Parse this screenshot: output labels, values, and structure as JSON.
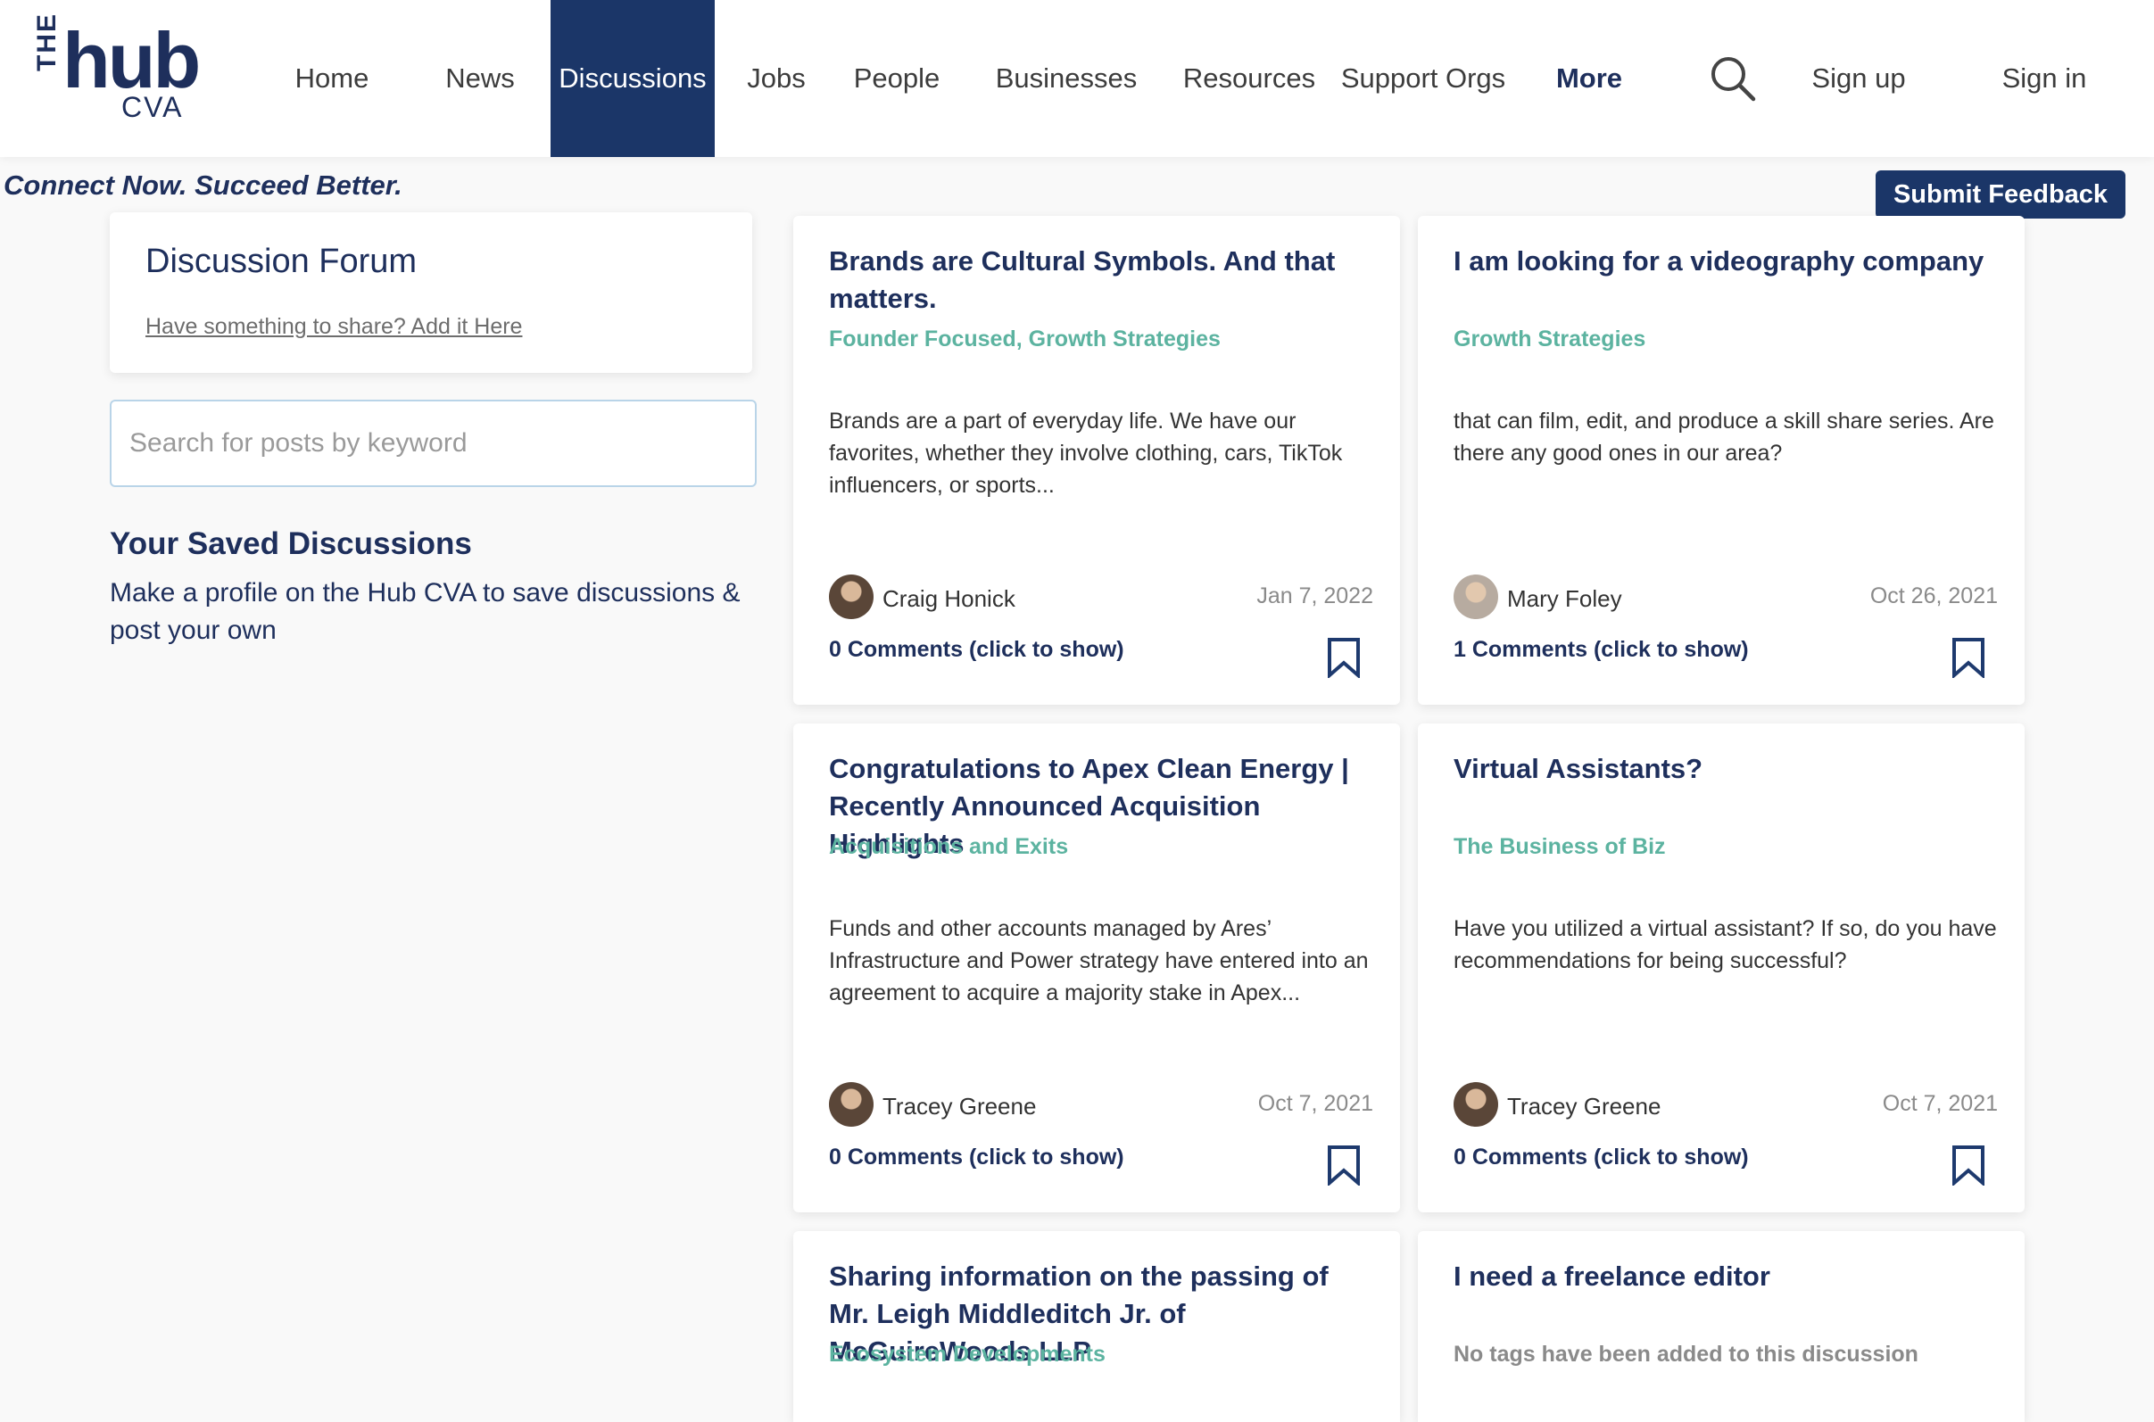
{
  "logo": {
    "the": "THE",
    "hub": "hub",
    "cva": "CVA"
  },
  "nav": {
    "items": [
      "Home",
      "News",
      "Discussions",
      "Jobs",
      "People",
      "Businesses",
      "Resources",
      "Support Orgs",
      "More"
    ],
    "active": "Discussions",
    "sign_up": "Sign up",
    "sign_in": "Sign in"
  },
  "tagline": "Connect Now. Succeed Better.",
  "feedback_label": "Submit Feedback",
  "forum": {
    "title": "Discussion Forum",
    "add_link": "Have something to share? Add it Here"
  },
  "search": {
    "placeholder": "Search for posts by keyword"
  },
  "saved": {
    "title": "Your Saved Discussions",
    "text": "Make a profile on the Hub CVA to save discussions & post your own"
  },
  "posts": [
    {
      "title": "Brands are Cultural Symbols. And that matters.",
      "tags": "Founder Focused, Growth Strategies",
      "excerpt": "Brands are a part of everyday life. We have our favorites, whether they involve clothing, cars, TikTok influencers, or sports...",
      "author": "Craig Honick",
      "date": "Jan 7, 2022",
      "comments": "0 Comments (click to show)"
    },
    {
      "title": "I am looking for a videography company",
      "tags": "Growth Strategies",
      "excerpt": "that can film, edit, and produce a skill share series.  Are there any good ones in our area?",
      "author": "Mary Foley",
      "date": "Oct 26, 2021",
      "comments": "1 Comments (click to show)"
    },
    {
      "title": "Congratulations to Apex Clean Energy | Recently Announced Acquisition Highlights",
      "tags": "Acquisitions and Exits",
      "excerpt": "Funds and other accounts managed by Ares’ Infrastructure and Power strategy have entered into an agreement to acquire a majority stake in Apex...",
      "author": "Tracey Greene",
      "date": "Oct 7, 2021",
      "comments": "0 Comments (click to show)"
    },
    {
      "title": "Virtual Assistants?",
      "tags": "The Business of Biz",
      "excerpt": "Have you utilized a virtual assistant? If so, do you have recommendations for being successful?",
      "author": "Tracey Greene",
      "date": "Oct 7, 2021",
      "comments": "0 Comments (click to show)"
    },
    {
      "title": "Sharing information on the passing of Mr. Leigh Middleditch Jr. of McGuireWoods LLP",
      "tags": "Ecosystem Developments"
    },
    {
      "title": "I need a freelance editor",
      "tags": "No tags have been added to this discussion"
    }
  ]
}
